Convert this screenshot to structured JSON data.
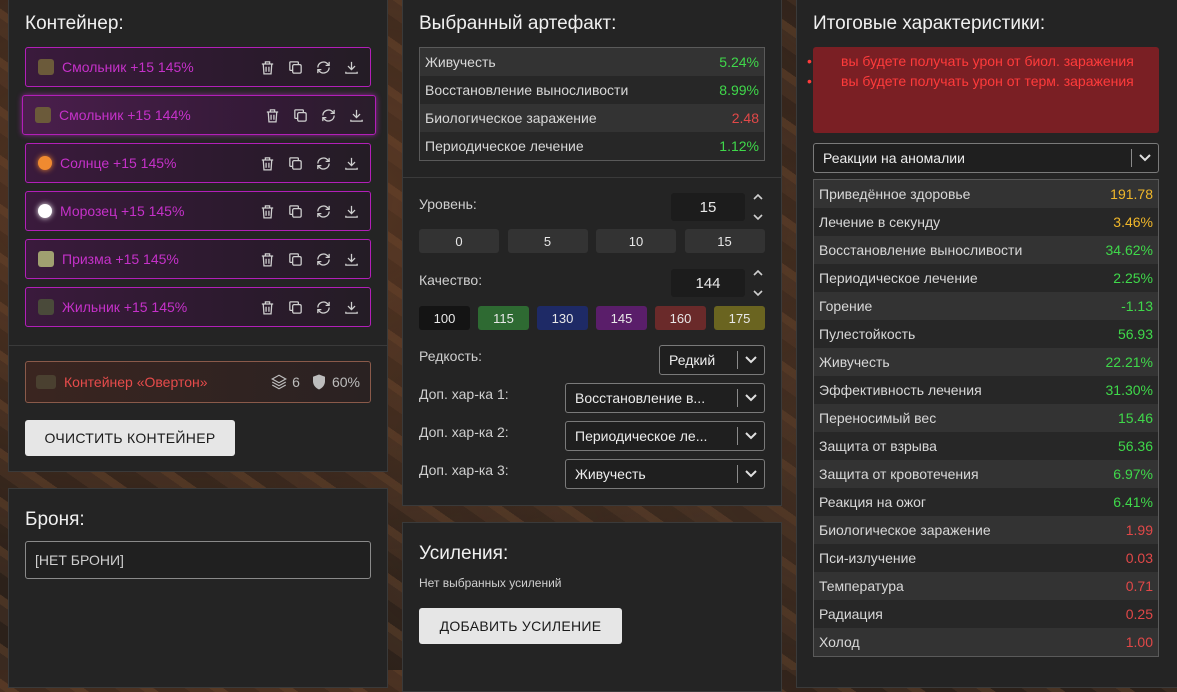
{
  "container_panel": {
    "title": "Контейнер:",
    "artifacts": [
      {
        "name": "Смольник +15 145%",
        "icon": "smolnik-icon",
        "color": "#6b5a3a"
      },
      {
        "name": "Смольник +15 144%",
        "icon": "smolnik-icon",
        "color": "#6b5a3a"
      },
      {
        "name": "Солнце +15 145%",
        "icon": "sun-icon",
        "color": "#f08a30"
      },
      {
        "name": "Морозец +15 145%",
        "icon": "frost-icon",
        "color": "#ffffff"
      },
      {
        "name": "Призма +15 145%",
        "icon": "prism-icon",
        "color": "#a0a070"
      },
      {
        "name": "Жильник +15 145%",
        "icon": "zhilnik-icon",
        "color": "#4a4a3a"
      }
    ],
    "container": {
      "name": "Контейнер «Овертон»",
      "slots": "6",
      "protection": "60%"
    },
    "clear_button": "ОЧИСТИТЬ КОНТЕЙНЕР"
  },
  "armor_panel": {
    "title": "Броня:",
    "value": "[НЕТ БРОНИ]"
  },
  "selected_panel": {
    "title": "Выбранный артефакт:",
    "stats": [
      {
        "name": "Живучесть",
        "value": "5.24%",
        "tone": "g"
      },
      {
        "name": "Восстановление выносливости",
        "value": "8.99%",
        "tone": "g"
      },
      {
        "name": "Биологическое заражение",
        "value": "2.48",
        "tone": "r"
      },
      {
        "name": "Периодическое лечение",
        "value": "1.12%",
        "tone": "g"
      }
    ],
    "level_label": "Уровень:",
    "level_value": "15",
    "level_presets": [
      "0",
      "5",
      "10",
      "15"
    ],
    "quality_label": "Качество:",
    "quality_value": "144",
    "quality_presets": [
      {
        "label": "100",
        "color": "#141414"
      },
      {
        "label": "115",
        "color": "#2e6a32"
      },
      {
        "label": "130",
        "color": "#1e2a66"
      },
      {
        "label": "145",
        "color": "#5a1e6a"
      },
      {
        "label": "160",
        "color": "#6a2a2a"
      },
      {
        "label": "175",
        "color": "#6a6420"
      }
    ],
    "rarity_label": "Редкость:",
    "rarity_value": "Редкий",
    "extra1_label": "Доп. хар-ка 1:",
    "extra1_value": "Восстановление в...",
    "extra2_label": "Доп. хар-ка 2:",
    "extra2_value": "Периодическое ле...",
    "extra3_label": "Доп. хар-ка 3:",
    "extra3_value": "Живучесть"
  },
  "boosts_panel": {
    "title": "Усиления:",
    "empty_text": "Нет выбранных усилений",
    "add_button": "ДОБАВИТЬ УСИЛЕНИЕ"
  },
  "totals_panel": {
    "title": "Итоговые характеристики:",
    "warnings": [
      "вы будете получать урон от биол. заражения",
      "вы будете получать урон от терм. заражения"
    ],
    "reactions_select": "Реакции на аномалии",
    "stats": [
      {
        "name": "Приведённое здоровье",
        "value": "191.78",
        "tone": "y"
      },
      {
        "name": "Лечение в секунду",
        "value": "3.46%",
        "tone": "y"
      },
      {
        "name": "Восстановление выносливости",
        "value": "34.62%",
        "tone": "g"
      },
      {
        "name": "Периодическое лечение",
        "value": "2.25%",
        "tone": "g"
      },
      {
        "name": "Горение",
        "value": "-1.13",
        "tone": "g"
      },
      {
        "name": "Пулестойкость",
        "value": "56.93",
        "tone": "g"
      },
      {
        "name": "Живучесть",
        "value": "22.21%",
        "tone": "g"
      },
      {
        "name": "Эффективность лечения",
        "value": "31.30%",
        "tone": "g"
      },
      {
        "name": "Переносимый вес",
        "value": "15.46",
        "tone": "g"
      },
      {
        "name": "Защита от взрыва",
        "value": "56.36",
        "tone": "g"
      },
      {
        "name": "Защита от кровотечения",
        "value": "6.97%",
        "tone": "g"
      },
      {
        "name": "Реакция на ожог",
        "value": "6.41%",
        "tone": "g"
      },
      {
        "name": "Биологическое заражение",
        "value": "1.99",
        "tone": "r"
      },
      {
        "name": "Пси-излучение",
        "value": "0.03",
        "tone": "r"
      },
      {
        "name": "Температура",
        "value": "0.71",
        "tone": "r"
      },
      {
        "name": "Радиация",
        "value": "0.25",
        "tone": "r"
      },
      {
        "name": "Холод",
        "value": "1.00",
        "tone": "r"
      }
    ]
  }
}
